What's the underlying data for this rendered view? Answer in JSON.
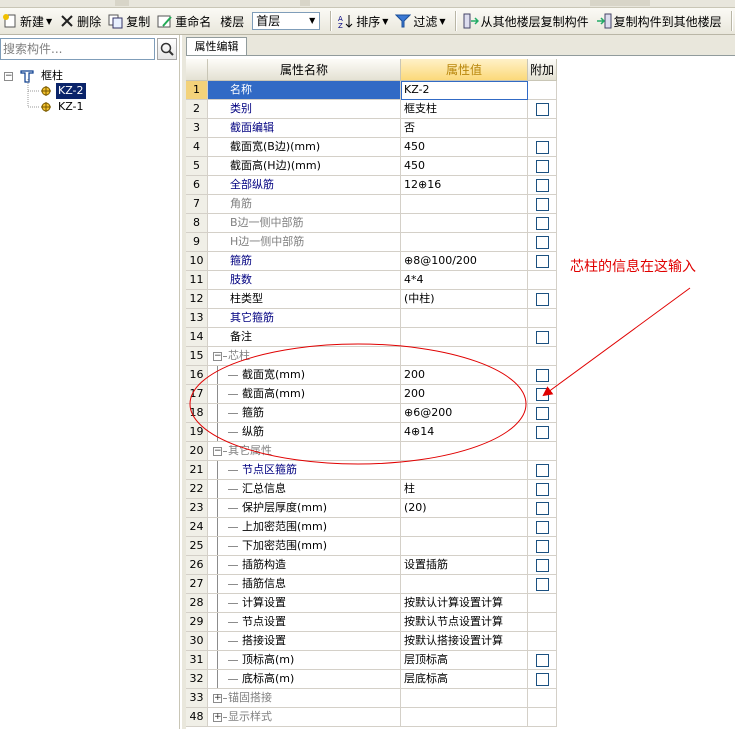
{
  "toolbar": {
    "new_label": "新建",
    "delete_label": "删除",
    "copy_label": "复制",
    "rename_label": "重命名",
    "floor_label": "楼层",
    "floor_value": "首层",
    "sort_label": "排序",
    "filter_label": "过滤",
    "copy_from_label": "从其他楼层复制构件",
    "copy_to_label": "复制构件到其他楼层"
  },
  "sidebar": {
    "search_placeholder": "搜索构件...",
    "root_label": "框柱",
    "items": [
      "KZ-2",
      "KZ-1"
    ],
    "selected": "KZ-2"
  },
  "panel": {
    "tab_label": "属性编辑",
    "headers": {
      "num": "",
      "name": "属性名称",
      "value": "属性值",
      "add": "附加"
    },
    "rows": [
      {
        "num": "1",
        "name": "名称",
        "value": "KZ-2",
        "level": 0,
        "style": "sel",
        "cb": false
      },
      {
        "num": "2",
        "name": "类别",
        "value": "框支柱",
        "level": 0,
        "style": "blue",
        "cb": true
      },
      {
        "num": "3",
        "name": "截面编辑",
        "value": "否",
        "level": 0,
        "style": "blue",
        "cb": false
      },
      {
        "num": "4",
        "name": "截面宽(B边)(mm)",
        "value": "450",
        "level": 0,
        "style": "black",
        "cb": true
      },
      {
        "num": "5",
        "name": "截面高(H边)(mm)",
        "value": "450",
        "level": 0,
        "style": "black",
        "cb": true
      },
      {
        "num": "6",
        "name": "全部纵筋",
        "value": "12⊕16",
        "level": 0,
        "style": "blue",
        "cb": true
      },
      {
        "num": "7",
        "name": "角筋",
        "value": "",
        "level": 0,
        "style": "gray",
        "cb": true
      },
      {
        "num": "8",
        "name": "B边一侧中部筋",
        "value": "",
        "level": 0,
        "style": "gray",
        "cb": true
      },
      {
        "num": "9",
        "name": "H边一侧中部筋",
        "value": "",
        "level": 0,
        "style": "gray",
        "cb": true
      },
      {
        "num": "10",
        "name": "箍筋",
        "value": "⊕8@100/200",
        "level": 0,
        "style": "blue",
        "cb": true
      },
      {
        "num": "11",
        "name": "肢数",
        "value": "4*4",
        "level": 0,
        "style": "blue",
        "cb": false
      },
      {
        "num": "12",
        "name": "柱类型",
        "value": "(中柱)",
        "level": 0,
        "style": "black",
        "cb": true
      },
      {
        "num": "13",
        "name": "其它箍筋",
        "value": "",
        "level": 0,
        "style": "blue",
        "cb": false
      },
      {
        "num": "14",
        "name": "备注",
        "value": "",
        "level": 0,
        "style": "black",
        "cb": true
      },
      {
        "num": "15",
        "name": "芯柱",
        "value": "",
        "level": "group",
        "style": "gray",
        "exp": "−",
        "cb": false
      },
      {
        "num": "16",
        "name": "截面宽(mm)",
        "value": "200",
        "level": 1,
        "style": "black",
        "cb": true
      },
      {
        "num": "17",
        "name": "截面高(mm)",
        "value": "200",
        "level": 1,
        "style": "black",
        "cb": true
      },
      {
        "num": "18",
        "name": "箍筋",
        "value": "⊕6@200",
        "level": 1,
        "style": "black",
        "cb": true
      },
      {
        "num": "19",
        "name": "纵筋",
        "value": "4⊕14",
        "level": 1,
        "style": "black",
        "cb": true
      },
      {
        "num": "20",
        "name": "其它属性",
        "value": "",
        "level": "group",
        "style": "gray",
        "exp": "−",
        "cb": false
      },
      {
        "num": "21",
        "name": "节点区箍筋",
        "value": "",
        "level": 1,
        "style": "blue",
        "cb": true
      },
      {
        "num": "22",
        "name": "汇总信息",
        "value": "柱",
        "level": 1,
        "style": "black",
        "cb": true
      },
      {
        "num": "23",
        "name": "保护层厚度(mm)",
        "value": "(20)",
        "level": 1,
        "style": "black",
        "cb": true
      },
      {
        "num": "24",
        "name": "上加密范围(mm)",
        "value": "",
        "level": 1,
        "style": "black",
        "cb": true
      },
      {
        "num": "25",
        "name": "下加密范围(mm)",
        "value": "",
        "level": 1,
        "style": "black",
        "cb": true
      },
      {
        "num": "26",
        "name": "插筋构造",
        "value": "设置插筋",
        "level": 1,
        "style": "black",
        "cb": true
      },
      {
        "num": "27",
        "name": "插筋信息",
        "value": "",
        "level": 1,
        "style": "black",
        "cb": true
      },
      {
        "num": "28",
        "name": "计算设置",
        "value": "按默认计算设置计算",
        "level": 1,
        "style": "black",
        "cb": false
      },
      {
        "num": "29",
        "name": "节点设置",
        "value": "按默认节点设置计算",
        "level": 1,
        "style": "black",
        "cb": false
      },
      {
        "num": "30",
        "name": "搭接设置",
        "value": "按默认搭接设置计算",
        "level": 1,
        "style": "black",
        "cb": false
      },
      {
        "num": "31",
        "name": "顶标高(m)",
        "value": "层顶标高",
        "level": 1,
        "style": "black",
        "cb": true
      },
      {
        "num": "32",
        "name": "底标高(m)",
        "value": "层底标高",
        "level": 1,
        "style": "black",
        "cb": true
      },
      {
        "num": "33",
        "name": "锚固搭接",
        "value": "",
        "level": "group",
        "style": "gray",
        "exp": "+",
        "cb": false
      },
      {
        "num": "48",
        "name": "显示样式",
        "value": "",
        "level": "group",
        "style": "gray",
        "exp": "+",
        "cb": false
      }
    ]
  },
  "annotation": {
    "text": "芯柱的信息在这输入",
    "color": "#e00000"
  },
  "colors": {
    "selection": "#316ac5",
    "blue_text": "#000080",
    "gray_text": "#808080",
    "header_value": "#b8860b"
  }
}
